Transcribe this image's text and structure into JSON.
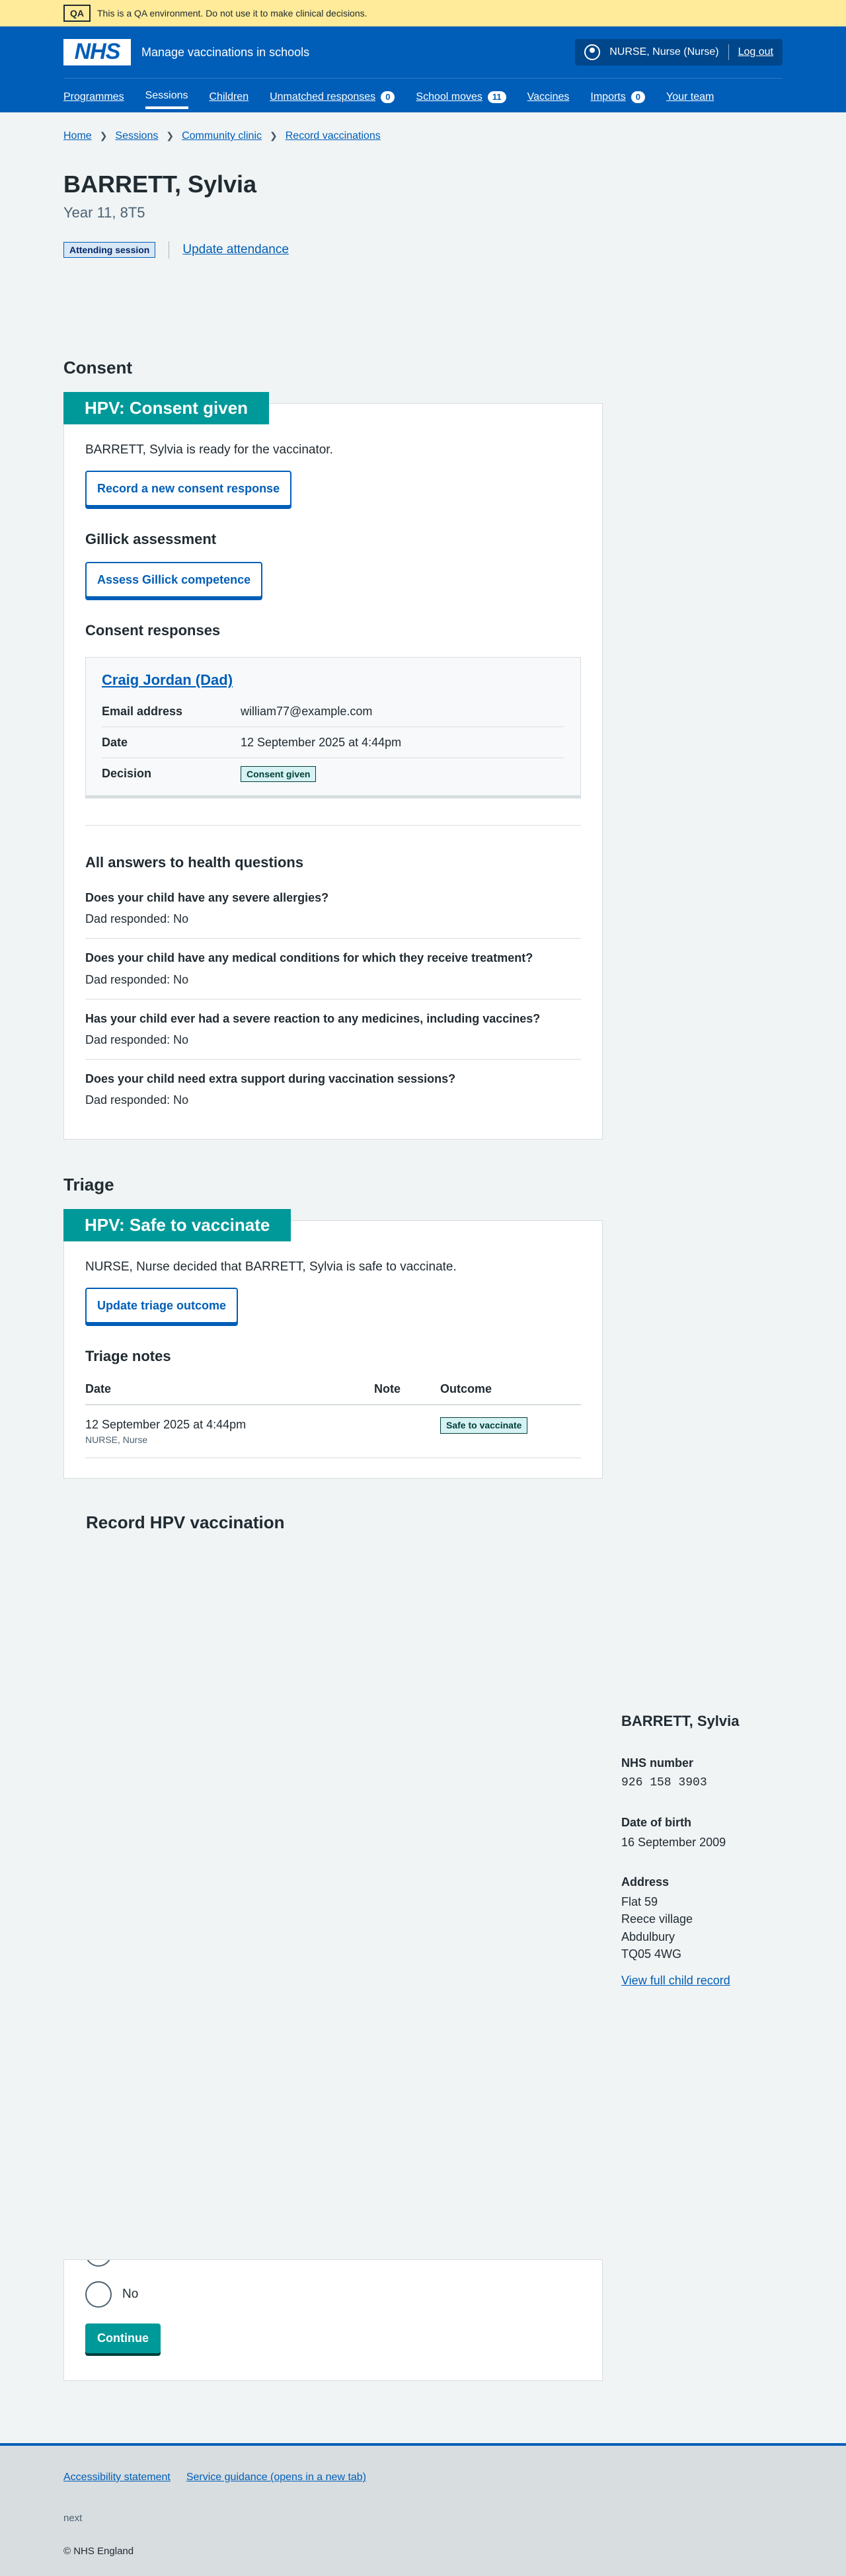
{
  "qa": {
    "tag": "QA",
    "message": "This is a QA environment. Do not use it to make clinical decisions."
  },
  "header": {
    "logo": "NHS",
    "service": "Manage vaccinations in schools",
    "user": "NURSE, Nurse (Nurse)",
    "logout": "Log out",
    "nav": [
      {
        "label": "Programmes"
      },
      {
        "label": "Sessions"
      },
      {
        "label": "Children"
      },
      {
        "label": "Unmatched responses",
        "count": "0"
      },
      {
        "label": "School moves",
        "count": "11"
      },
      {
        "label": "Vaccines"
      },
      {
        "label": "Imports",
        "count": "0"
      },
      {
        "label": "Your team"
      }
    ]
  },
  "breadcrumb": [
    "Home",
    "Sessions",
    "Community clinic",
    "Record vaccinations"
  ],
  "patient": {
    "name": "BARRETT, Sylvia",
    "caption": "Year 11, 8T5"
  },
  "attendance": {
    "tag": "Attending session",
    "link": "Update attendance"
  },
  "consent": {
    "heading": "Consent",
    "card_title": "HPV: Consent given",
    "ready_text": "BARRETT, Sylvia is ready for the vaccinator.",
    "record_button": "Record a new consent response",
    "gillick_heading": "Gillick assessment",
    "gillick_button": "Assess Gillick competence",
    "responses_heading": "Consent responses",
    "response": {
      "name": "Craig Jordan (Dad)",
      "email_label": "Email address",
      "email": "william77@example.com",
      "date_label": "Date",
      "date": "12 September 2025 at 4:44pm",
      "decision_label": "Decision",
      "decision": "Consent given"
    },
    "health_heading": "All answers to health questions",
    "health": [
      {
        "q": "Does your child have any severe allergies?",
        "a": "Dad responded: No"
      },
      {
        "q": "Does your child have any medical conditions for which they receive treatment?",
        "a": "Dad responded: No"
      },
      {
        "q": "Has your child ever had a severe reaction to any medicines, including vaccines?",
        "a": "Dad responded: No"
      },
      {
        "q": "Does your child need extra support during vaccination sessions?",
        "a": "Dad responded: No"
      }
    ]
  },
  "triage": {
    "heading": "Triage",
    "card_title": "HPV: Safe to vaccinate",
    "text": "NURSE, Nurse decided that BARRETT, Sylvia is safe to vaccinate.",
    "button": "Update triage outcome",
    "notes_heading": "Triage notes",
    "columns": {
      "date": "Date",
      "note": "Note",
      "outcome": "Outcome"
    },
    "row": {
      "date": "12 September 2025 at 4:44pm",
      "by": "NURSE, Nurse",
      "note": "",
      "outcome": "Safe to vaccinate"
    }
  },
  "record": {
    "title": "Record HPV vaccination",
    "no": "No",
    "continue": "Continue"
  },
  "sidebar": {
    "name": "BARRETT, Sylvia",
    "nhs_label": "NHS number",
    "nhs": "926 158 3903",
    "dob_label": "Date of birth",
    "dob": "16 September 2009",
    "address_label": "Address",
    "address": [
      "Flat 59",
      "Reece village",
      "Abdulbury",
      "TQ05 4WG"
    ],
    "link": "View full child record"
  },
  "footer": {
    "links": [
      "Accessibility statement",
      "Service guidance (opens in a new tab)"
    ],
    "meta": "next",
    "copyright": "© NHS England"
  }
}
